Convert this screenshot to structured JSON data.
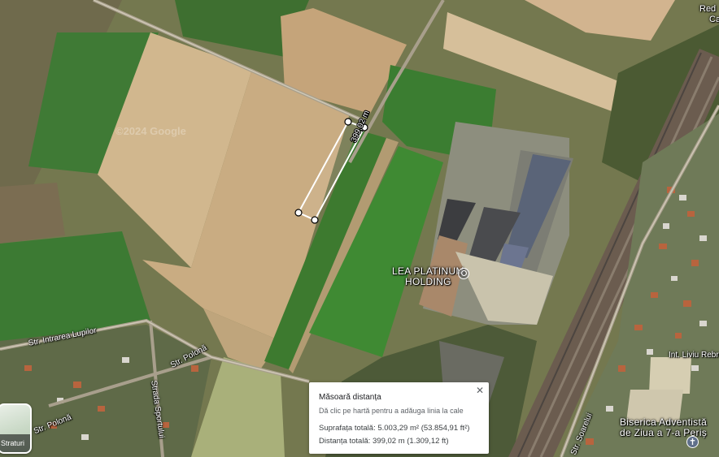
{
  "map": {
    "imagery_watermark": "©2024 Google"
  },
  "labels": {
    "poi_lea": "LEA PLATINUM\nHOLDING",
    "red_top": "Red",
    "red_top2": "Ca",
    "str_intrarea_lupilor": "Str. Intrarea Lupilor",
    "str_polona_1": "Str. Polonă",
    "str_polona_2": "Str. Polonă",
    "strada_sportului": "Strada Sportului",
    "int_liviu_rebreanu": "Int. Liviu Rebre",
    "str_soarelui": "Str. Soarelui",
    "biserica": "Biserica Adventistă\nde Ziua a 7-a Periș"
  },
  "measure": {
    "segment_label": "399,02 m"
  },
  "panel": {
    "title": "Măsoară distanța",
    "hint": "Dă clic pe hartă pentru a adăuga linia la cale",
    "area": "Suprafața totală: 5.003,29 m² (53.854,91 ft²)",
    "distance": "Distanța totală: 399,02 m (1.309,12 ft)",
    "close_icon": "close-icon"
  },
  "layers_button": {
    "label": "Straturi",
    "icon": "layers-icon"
  },
  "colors": {
    "measure_line": "#ffffff",
    "panel_bg": "#ffffff"
  }
}
